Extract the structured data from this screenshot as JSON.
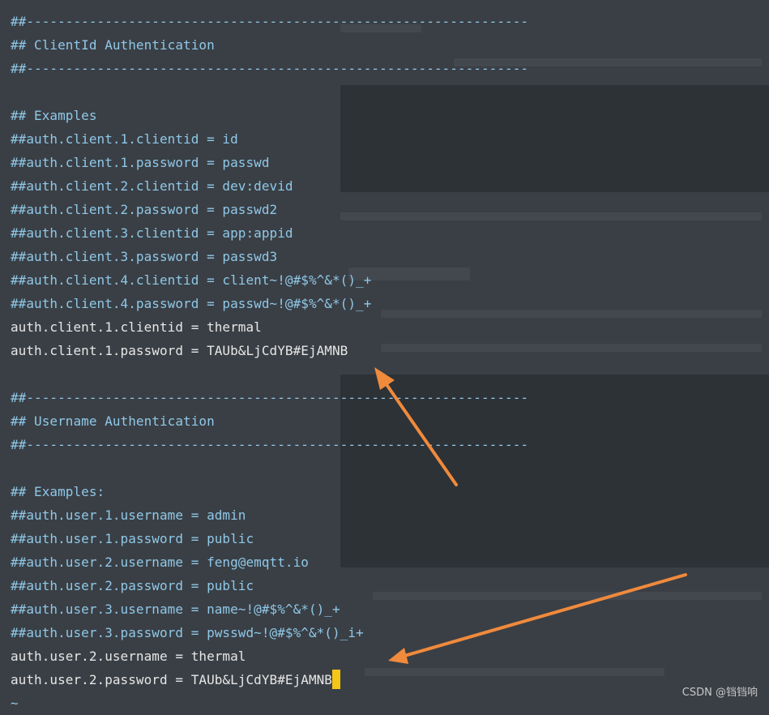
{
  "editor": {
    "lines": [
      {
        "text": "##----------------------------------------------------------------",
        "kind": "comment"
      },
      {
        "text": "## ClientId Authentication",
        "kind": "comment"
      },
      {
        "text": "##----------------------------------------------------------------",
        "kind": "comment"
      },
      {
        "text": "",
        "kind": "comment"
      },
      {
        "text": "## Examples",
        "kind": "comment"
      },
      {
        "text": "##auth.client.1.clientid = id",
        "kind": "comment"
      },
      {
        "text": "##auth.client.1.password = passwd",
        "kind": "comment"
      },
      {
        "text": "##auth.client.2.clientid = dev:devid",
        "kind": "comment"
      },
      {
        "text": "##auth.client.2.password = passwd2",
        "kind": "comment"
      },
      {
        "text": "##auth.client.3.clientid = app:appid",
        "kind": "comment"
      },
      {
        "text": "##auth.client.3.password = passwd3",
        "kind": "comment"
      },
      {
        "text": "##auth.client.4.clientid = client~!@#$%^&*()_+",
        "kind": "comment"
      },
      {
        "text": "##auth.client.4.password = passwd~!@#$%^&*()_+",
        "kind": "comment"
      },
      {
        "text": "auth.client.1.clientid = thermal",
        "kind": "code"
      },
      {
        "text": "auth.client.1.password = TAUb&LjCdYB#EjAMNB",
        "kind": "code"
      },
      {
        "text": "",
        "kind": "comment"
      },
      {
        "text": "##----------------------------------------------------------------",
        "kind": "comment"
      },
      {
        "text": "## Username Authentication",
        "kind": "comment"
      },
      {
        "text": "##----------------------------------------------------------------",
        "kind": "comment"
      },
      {
        "text": "",
        "kind": "comment"
      },
      {
        "text": "## Examples:",
        "kind": "comment"
      },
      {
        "text": "##auth.user.1.username = admin",
        "kind": "comment"
      },
      {
        "text": "##auth.user.1.password = public",
        "kind": "comment"
      },
      {
        "text": "##auth.user.2.username = feng@emqtt.io",
        "kind": "comment"
      },
      {
        "text": "##auth.user.2.password = public",
        "kind": "comment"
      },
      {
        "text": "##auth.user.3.username = name~!@#$%^&*()_+",
        "kind": "comment"
      },
      {
        "text": "##auth.user.3.password = pwsswd~!@#$%^&*()_i+",
        "kind": "comment"
      },
      {
        "text": "auth.user.2.username = thermal",
        "kind": "code"
      },
      {
        "text": "auth.user.2.password = TAUb&LjCdYB#EjAMNB",
        "kind": "code"
      },
      {
        "text": "~",
        "kind": "tilde"
      }
    ]
  },
  "colors": {
    "background": "#3a3f45",
    "comment": "#8fc8e8",
    "code": "#e6e6e6",
    "cursor": "#f5c518",
    "arrow": "#f08a3c"
  },
  "watermark": "CSDN @铛铛响"
}
